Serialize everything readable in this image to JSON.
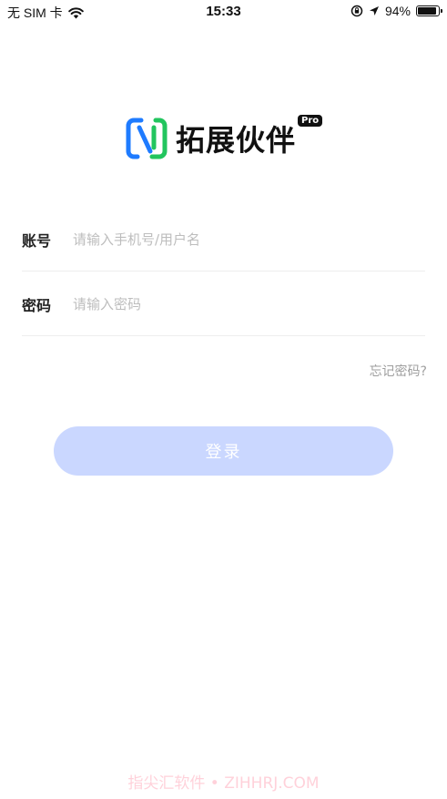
{
  "status_bar": {
    "carrier": "无 SIM 卡",
    "time": "15:33",
    "battery_percent": "94%",
    "battery_level": 0.94,
    "icons": [
      "wifi-icon",
      "orientation-lock-icon",
      "location-arrow-icon",
      "battery-icon"
    ]
  },
  "logo": {
    "text": "拓展伙伴",
    "badge": "Pro",
    "colors": {
      "blue": "#1e7bff",
      "green": "#22c55e",
      "dark": "#111111"
    }
  },
  "form": {
    "account": {
      "label": "账号",
      "placeholder": "请输入手机号/用户名",
      "value": ""
    },
    "password": {
      "label": "密码",
      "placeholder": "请输入密码",
      "value": ""
    },
    "forgot_password": "忘记密码?",
    "login_button": "登录",
    "login_button_color": "#cad7ff"
  },
  "watermark": "指尖汇软件 • ZIHHRJ.COM"
}
